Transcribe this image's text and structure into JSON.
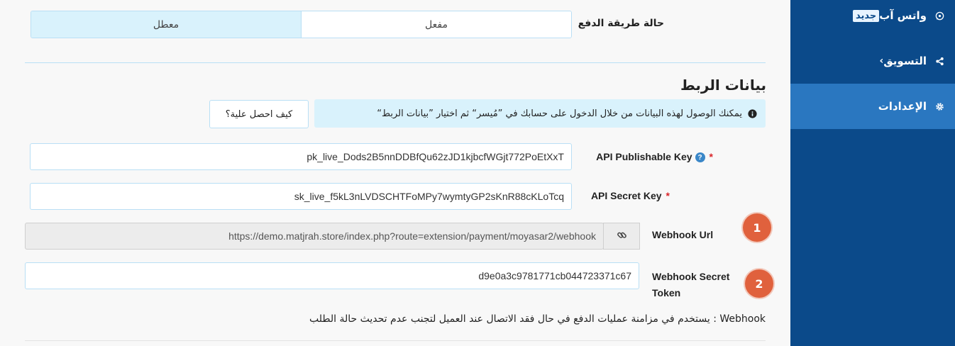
{
  "sidebar": {
    "items": [
      {
        "label": "واتس آب",
        "badge": "جديد",
        "icon": "whatsapp-icon"
      },
      {
        "label": "التسويق",
        "icon": "share-icon",
        "chevron": "‹"
      },
      {
        "label": "الإعدادات",
        "icon": "gear-icon",
        "active": true
      }
    ]
  },
  "payment_status": {
    "label": "حالة طريقة الدفع",
    "enabled_label": "مفعل",
    "disabled_label": "معطل"
  },
  "connection": {
    "title": "بيانات الربط",
    "info_text": "يمكنك الوصول لهذه البيانات من خلال الدخول على حسابك في ”مُيسر“ ثم اختيار ”بيانات الربط“",
    "how_button": "كيف احصل علية؟"
  },
  "fields": {
    "publishable_key": {
      "label": "API Publishable Key",
      "required": "*",
      "help": "?",
      "value": "pk_live_Dods2B5nnDDBfQu62zJD1kjbcfWGjt772PoEtXxT"
    },
    "secret_key": {
      "label": "API Secret Key",
      "required": "*",
      "value": "sk_live_f5kL3nLVDSCHTFoMPy7wymtyGP2sKnR88cKLoTcq"
    },
    "webhook_url": {
      "label": "Webhook Url",
      "value": "https://demo.matjrah.store/index.php?route=extension/payment/moyasar2/webhook"
    },
    "webhook_token": {
      "label": "Webhook Secret Token",
      "value": "d9e0a3c9781771cb044723371c67"
    }
  },
  "steps": [
    "1",
    "2"
  ],
  "webhook_note": "Webhook : يستخدم في مزامنة عمليات الدفع في حال فقد الاتصال عند العميل لتجنب عدم تحديث حالة الطلب",
  "colors": {
    "sidebar": "#0b4a8a",
    "sidebar_active": "#2a77c0",
    "accent_light": "#d9f2fc",
    "step": "#e0613d",
    "required": "#d9252a"
  }
}
